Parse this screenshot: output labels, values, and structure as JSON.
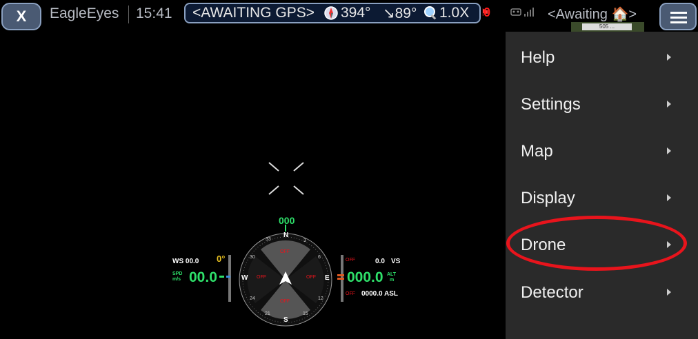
{
  "topbar": {
    "close_label": "X",
    "app_name": "EagleEyes",
    "clock": "15:41",
    "gps_status": "<AWAITING GPS>",
    "heading": "394°",
    "pitch": "↘89°",
    "zoom": "1.0X",
    "alert_count": "0",
    "home_status": "<Awaiting",
    "home_suffix": ">",
    "map_label": "505 ..."
  },
  "menu": {
    "items": [
      {
        "label": "Help"
      },
      {
        "label": "Settings"
      },
      {
        "label": "Map"
      },
      {
        "label": "Display"
      },
      {
        "label": "Drone"
      },
      {
        "label": "Detector"
      }
    ]
  },
  "hud": {
    "ws": "WS 00.0",
    "wind_dir": "0°",
    "spd_label_top": "SPD",
    "spd_label_bot": "m/s",
    "speed": "00.0",
    "off_left": "OFF",
    "vs_value": "0.0",
    "vs_label": "VS",
    "altitude": "000.0",
    "alt_label_top": "ALT",
    "alt_label_bot": "m",
    "asl_off": "OFF",
    "asl": "0000.0 ASL",
    "compass_heading": "000",
    "compass_n": "N",
    "compass_s": "S",
    "compass_e": "E",
    "compass_w": "W",
    "off_top": "OFF",
    "off_bottom": "OFF",
    "off_w": "OFF",
    "off_e": "OFF",
    "tick_33": "33",
    "tick_30": "30",
    "tick_6": "6",
    "tick_3": "3",
    "tick_12": "12",
    "tick_15": "15",
    "tick_21": "21",
    "tick_24": "24"
  },
  "colors": {
    "accent_green": "#2ee06a",
    "alert_red": "#ff1a1a",
    "highlight_red": "#e8141c",
    "menu_bg": "#2a2a2a",
    "button_bg": "#4a5a73",
    "compass_heading_color": "#e8a020"
  }
}
